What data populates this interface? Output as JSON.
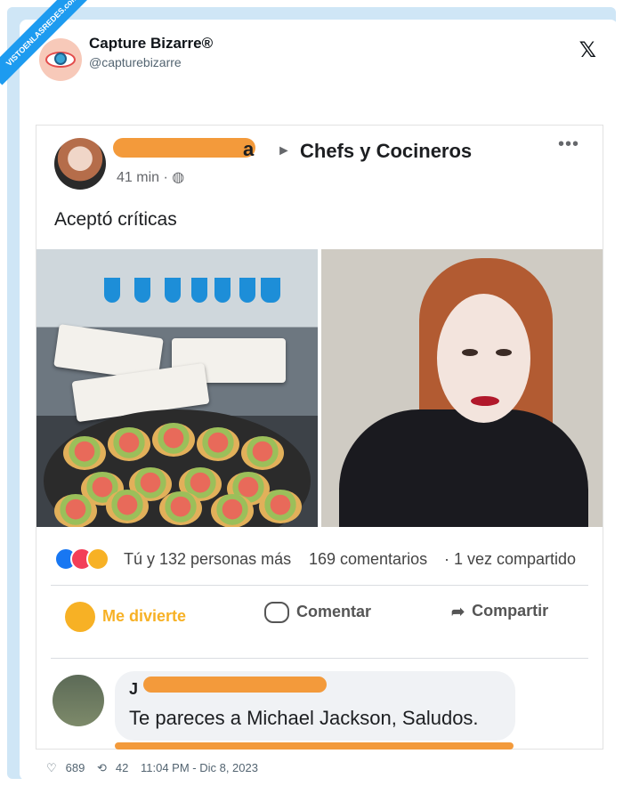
{
  "watermark": "VISTOENLASREDES.com",
  "tweet": {
    "account_name": "Capture Bizarre®",
    "handle": "@capturebizarre",
    "likes": "689",
    "retweets": "42",
    "timestamp": "11:04 PM - Dic 8, 2023"
  },
  "fb_post": {
    "author_tail": "a",
    "arrow": "►",
    "group": "Chefs y Cocineros",
    "time": "41 min ·",
    "more": "•••",
    "text": "Aceptó críticas",
    "reactions_text": "Tú y 132 personas más",
    "comments_count": "169 comentarios",
    "shares": "· 1 vez compartido",
    "actions": {
      "react": "Me divierte",
      "comment": "Comentar",
      "share": "Compartir"
    },
    "comment": {
      "author_prefix": "J",
      "text": "Te pareces a Michael Jackson, Saludos."
    }
  },
  "colors": {
    "accent": "#1d9bf0",
    "redaction": "#f39a3b",
    "fb_text": "#1c1e21"
  }
}
